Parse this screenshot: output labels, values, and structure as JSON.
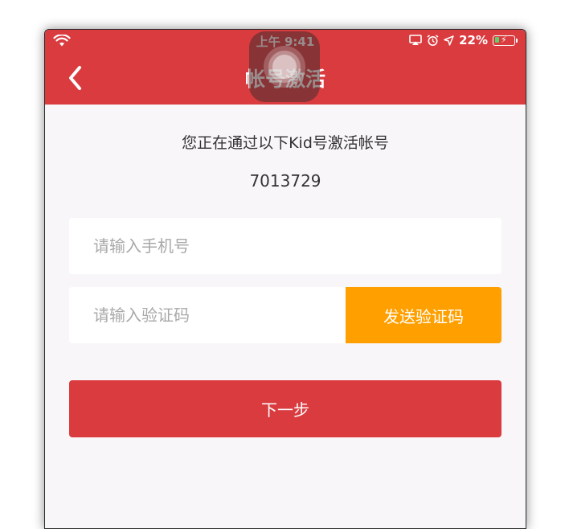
{
  "status_bar": {
    "time": "上午 9:41",
    "battery_percent": "22%",
    "battery_level": 0.22,
    "icons": [
      "wifi-icon",
      "airplay-icon",
      "alarm-icon",
      "location-icon",
      "battery-icon"
    ]
  },
  "nav": {
    "title": "帐号激活",
    "back_icon": "chevron-left-icon"
  },
  "content": {
    "intro": "您正在通过以下Kid号激活帐号",
    "kid_number": "7013729"
  },
  "form": {
    "phone_placeholder": "请输入手机号",
    "phone_value": "",
    "code_placeholder": "请输入验证码",
    "code_value": "",
    "send_code_label": "发送验证码",
    "next_label": "下一步"
  },
  "colors": {
    "brand_red": "#d93b3f",
    "accent_orange": "#ff9f00",
    "background": "#f8f6f9"
  }
}
